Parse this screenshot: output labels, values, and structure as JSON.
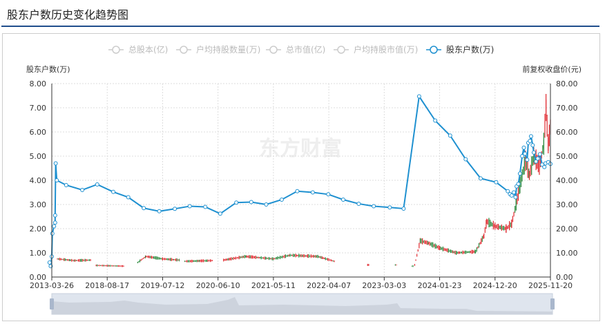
{
  "title": "股东户数历史变化趋势图",
  "legend": [
    {
      "label": "总股本(亿)",
      "active": false
    },
    {
      "label": "户均持股数量(万)",
      "active": false
    },
    {
      "label": "总市值(亿)",
      "active": false
    },
    {
      "label": "户均持股市值(万)",
      "active": false
    },
    {
      "label": "股东户数(万)",
      "active": true
    }
  ],
  "watermark": "东方财富",
  "colors": {
    "line": "#1e90d0",
    "up": "#e0282e",
    "down": "#2b8a3e",
    "inactive": "#cccccc"
  },
  "chart_data": {
    "type": "line",
    "title": "股东户数历史变化趋势图",
    "ylabel": "股东户数(万)",
    "ylabel_right": "前复权收盘价(元)",
    "ylim": [
      0,
      8
    ],
    "ylim_right": [
      0,
      80
    ],
    "yticks": [
      "0.00",
      "1.00",
      "2.00",
      "3.00",
      "4.00",
      "5.00",
      "6.00",
      "7.00",
      "8.00"
    ],
    "yticks_right": [
      "0.00",
      "10.00",
      "20.00",
      "30.00",
      "40.00",
      "50.00",
      "60.00",
      "70.00",
      "80.00"
    ],
    "categories": [
      "2013-03-26",
      "2018-08-17",
      "2019-07-12",
      "2020-06-10",
      "2021-05-11",
      "2022-04-07",
      "2023-03-03",
      "2024-01-23",
      "2024-12-20",
      "2025-11-20"
    ],
    "series": [
      {
        "name": "股东户数(万)",
        "points": [
          [
            -0.04,
            0.6
          ],
          [
            -0.02,
            0.45
          ],
          [
            0,
            0.85
          ],
          [
            0.01,
            1.8
          ],
          [
            0.04,
            2.1
          ],
          [
            0.06,
            2.25
          ],
          [
            0.06,
            2.55
          ],
          [
            0.07,
            4.7
          ],
          [
            0.09,
            4.0
          ],
          [
            0.26,
            3.8
          ],
          [
            0.55,
            3.6
          ],
          [
            0.82,
            3.83
          ],
          [
            1.11,
            3.52
          ],
          [
            1.38,
            3.3
          ],
          [
            1.66,
            2.85
          ],
          [
            1.94,
            2.72
          ],
          [
            2.22,
            2.82
          ],
          [
            2.49,
            2.93
          ],
          [
            2.77,
            2.9
          ],
          [
            3.04,
            2.62
          ],
          [
            3.33,
            3.08
          ],
          [
            3.6,
            3.1
          ],
          [
            3.87,
            3.0
          ],
          [
            4.15,
            3.2
          ],
          [
            4.43,
            3.55
          ],
          [
            4.71,
            3.5
          ],
          [
            4.99,
            3.42
          ],
          [
            5.26,
            3.2
          ],
          [
            5.54,
            3.03
          ],
          [
            5.81,
            2.93
          ],
          [
            6.1,
            2.88
          ],
          [
            6.35,
            2.83
          ],
          [
            6.63,
            7.47
          ],
          [
            6.92,
            6.47
          ],
          [
            7.19,
            5.85
          ],
          [
            7.47,
            4.87
          ],
          [
            7.74,
            4.08
          ],
          [
            8.02,
            3.92
          ],
          [
            8.23,
            3.55
          ],
          [
            8.27,
            3.43
          ],
          [
            8.3,
            3.37
          ],
          [
            8.34,
            3.5
          ],
          [
            8.37,
            3.3
          ],
          [
            8.39,
            3.75
          ],
          [
            8.42,
            3.85
          ],
          [
            8.45,
            4.28
          ],
          [
            8.49,
            5.0
          ],
          [
            8.52,
            5.35
          ],
          [
            8.54,
            5.1
          ],
          [
            8.58,
            4.85
          ],
          [
            8.6,
            5.55
          ],
          [
            8.63,
            5.63
          ],
          [
            8.65,
            5.82
          ],
          [
            8.68,
            5.45
          ],
          [
            8.7,
            5.15
          ],
          [
            8.74,
            4.78
          ],
          [
            8.77,
            4.9
          ],
          [
            8.81,
            5.08
          ],
          [
            8.85,
            4.65
          ],
          [
            8.89,
            4.55
          ],
          [
            8.91,
            4.7
          ],
          [
            8.96,
            4.75
          ],
          [
            9.0,
            4.68
          ]
        ]
      },
      {
        "name": "前复权收盘价(元)",
        "type": "candlestick",
        "segments": [
          [
            [
              0.1,
              7.5
            ],
            [
              0.4,
              6.8
            ],
            [
              0.7,
              7
            ]
          ],
          [
            [
              0.8,
              4.8
            ],
            [
              1.3,
              4.5
            ]
          ],
          [
            [
              1.55,
              6
            ],
            [
              1.7,
              8.5
            ],
            [
              2.0,
              7.5
            ],
            [
              2.3,
              7
            ]
          ],
          [
            [
              2.4,
              6.5
            ],
            [
              2.9,
              6.8
            ]
          ],
          [
            [
              3.1,
              7
            ],
            [
              3.5,
              8.5
            ],
            [
              4.0,
              7.5
            ],
            [
              4.3,
              9
            ],
            [
              4.8,
              8.5
            ],
            [
              5.1,
              6.5
            ]
          ],
          [
            [
              5.7,
              5
            ],
            [
              5.72,
              5
            ]
          ],
          [
            [
              6.2,
              5
            ],
            [
              6.22,
              5
            ]
          ],
          [
            [
              6.5,
              4.5
            ],
            [
              6.52,
              4.5
            ]
          ],
          [
            [
              6.55,
              5
            ],
            [
              6.65,
              15
            ],
            [
              6.8,
              14
            ],
            [
              7.0,
              12
            ],
            [
              7.3,
              10
            ],
            [
              7.65,
              10.5
            ],
            [
              7.8,
              17
            ],
            [
              7.85,
              23
            ],
            [
              8.0,
              21
            ],
            [
              8.2,
              20
            ],
            [
              8.3,
              22
            ],
            [
              8.38,
              30
            ],
            [
              8.45,
              38
            ],
            [
              8.55,
              48
            ],
            [
              8.62,
              42
            ],
            [
              8.7,
              50
            ],
            [
              8.8,
              46
            ],
            [
              8.88,
              55
            ],
            [
              8.92,
              70
            ],
            [
              8.96,
              55
            ],
            [
              9.0,
              62
            ]
          ]
        ]
      }
    ]
  }
}
